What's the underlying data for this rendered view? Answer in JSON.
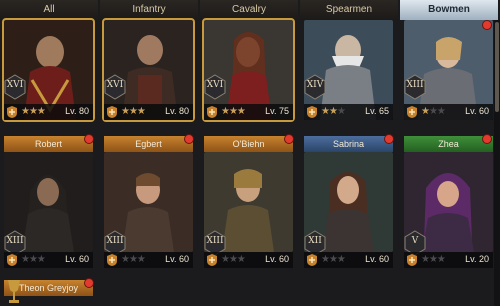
{
  "tabs": [
    "All",
    "Infantry",
    "Cavalry",
    "Spearmen",
    "Bowmen"
  ],
  "active_tab": 4,
  "heroes_row1": [
    {
      "rank": "XVI",
      "stars": 3,
      "level": "Lv. 80"
    },
    {
      "rank": "XVI",
      "stars": 3,
      "level": "Lv. 80"
    },
    {
      "rank": "XVI",
      "stars": 3,
      "level": "Lv. 75"
    },
    {
      "rank": "XIV",
      "stars": 2,
      "level": "Lv. 65"
    },
    {
      "rank": "XIII",
      "stars": 1,
      "level": "Lv. 60"
    }
  ],
  "heroes_row2": [
    {
      "name": "Robert",
      "bar": "orange",
      "rank": "XIII",
      "stars": 0,
      "level": "Lv. 60"
    },
    {
      "name": "Egbert",
      "bar": "orange",
      "rank": "XIII",
      "stars": 0,
      "level": "Lv. 60"
    },
    {
      "name": "O'Biehn",
      "bar": "orange",
      "rank": "XIII",
      "stars": 0,
      "level": "Lv. 60"
    },
    {
      "name": "Sabrina",
      "bar": "blue",
      "rank": "XII",
      "stars": 0,
      "level": "Lv. 60"
    },
    {
      "name": "Zhea",
      "bar": "green",
      "rank": "V",
      "stars": 0,
      "level": "Lv. 20"
    }
  ],
  "hero_row3": {
    "name": "Theon Greyjoy"
  },
  "colors": {
    "gold": "#c79a3e",
    "alert": "#e23b2e"
  }
}
